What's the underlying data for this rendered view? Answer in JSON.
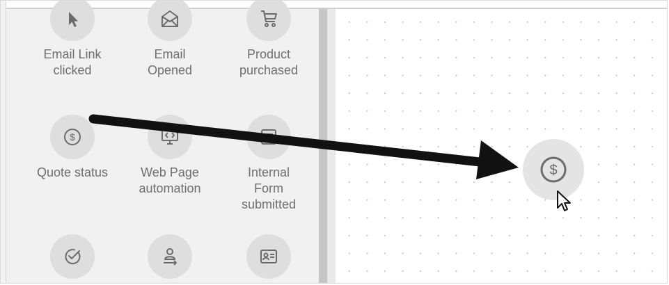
{
  "palette": {
    "items": [
      {
        "label": "Email Link\nclicked",
        "icon": "pointer-icon"
      },
      {
        "label": "Email\nOpened",
        "icon": "envelope-open-icon"
      },
      {
        "label": "Product\npurchased",
        "icon": "cart-icon"
      },
      {
        "label": "Quote status",
        "icon": "dollar-circle-icon"
      },
      {
        "label": "Web Page\nautomation",
        "icon": "monitor-code-icon"
      },
      {
        "label": "Internal\nForm\nsubmitted",
        "icon": "form-icon"
      },
      {
        "label": "",
        "icon": "check-circle-icon"
      },
      {
        "label": "",
        "icon": "person-arrow-icon"
      },
      {
        "label": "",
        "icon": "id-card-icon"
      }
    ]
  },
  "canvas": {
    "dropped_node_icon": "dollar-circle-icon",
    "annotation": "arrow-annotation",
    "cursor": "mouse-pointer-icon"
  },
  "colors": {
    "palette_bg": "#f1f1f1",
    "icon_circle": "#dedede",
    "icon_stroke": "#6b6b6b",
    "label_text": "#6e6e6e",
    "arrow": "#111111"
  }
}
